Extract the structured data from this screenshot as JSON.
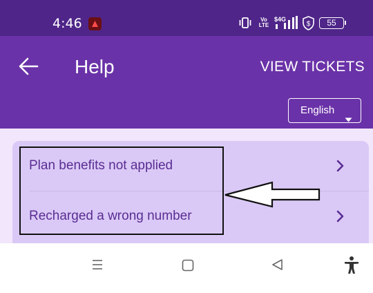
{
  "status_bar": {
    "time": "4:46",
    "network_label": "Vo LTE",
    "signal_label": "4G",
    "battery_level": "55",
    "icons": [
      "alert-icon",
      "vibrate-icon",
      "volte-icon",
      "signal-icon",
      "shield-icon",
      "battery-icon"
    ]
  },
  "header": {
    "back_icon": "arrow-left-icon",
    "title": "Help",
    "view_tickets_label": "VIEW TICKETS",
    "language_selected": "English",
    "language_caret_icon": "caret-down-icon"
  },
  "help_topics": [
    {
      "label": "Plan benefits not applied",
      "icon": "chevron-right-icon"
    },
    {
      "label": "Recharged a wrong number",
      "icon": "chevron-right-icon"
    }
  ],
  "annotation": {
    "box": "highlight-box",
    "arrow": "left-arrow-icon"
  },
  "nav_bar": {
    "icons": [
      "menu-icon",
      "home-icon",
      "back-icon",
      "accessibility-icon"
    ]
  },
  "colors": {
    "status_bar": "#4f2589",
    "app_bar": "#6a32a8",
    "page_background": "#f1e6fb",
    "card": "#dac9f6",
    "item_text": "#5a2d93"
  }
}
